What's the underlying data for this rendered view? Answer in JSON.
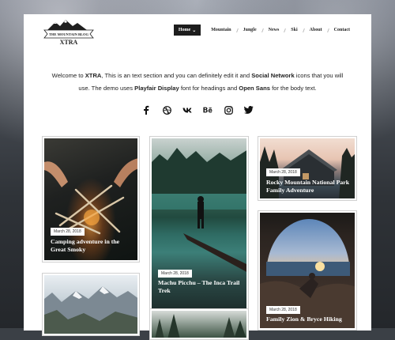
{
  "logo": {
    "top_text": "THE MOUNTAIN BLOG",
    "name": "XTRA"
  },
  "nav": {
    "items": [
      {
        "label": "Home",
        "active": true
      },
      {
        "label": "Mountain"
      },
      {
        "label": "Jungle"
      },
      {
        "label": "News"
      },
      {
        "label": "Ski"
      },
      {
        "label": "About"
      },
      {
        "label": "Contact"
      }
    ],
    "dropdown_glyph": "⌄"
  },
  "intro": {
    "p1": "Welcome to ",
    "b1": "XTRA",
    "p2": ", This is an text section and you can definitely edit it and ",
    "b2": "Social Network",
    "p3": " icons that you will use. The demo uses ",
    "b3": "Playfair Display",
    "p4": " font for headings and ",
    "b4": "Open Sans",
    "p5": " for the body text."
  },
  "social_icons": [
    "facebook-icon",
    "dribbble-icon",
    "vk-icon",
    "behance-icon",
    "instagram-icon",
    "twitter-icon"
  ],
  "posts": [
    {
      "date": "March 28, 2018",
      "title": "Camping adventure in the Great Smoky"
    },
    {
      "date": "March 28, 2018",
      "title": "Machu Picchu – The Inca Trail Trek"
    },
    {
      "date": "March 28, 2018",
      "title": "Rocky Mountain National Park Family Adventure"
    },
    {
      "date": "March 28, 2018",
      "title": "Family Zion & Bryce Hiking"
    },
    {
      "date": "",
      "title": ""
    },
    {
      "date": "",
      "title": ""
    }
  ]
}
